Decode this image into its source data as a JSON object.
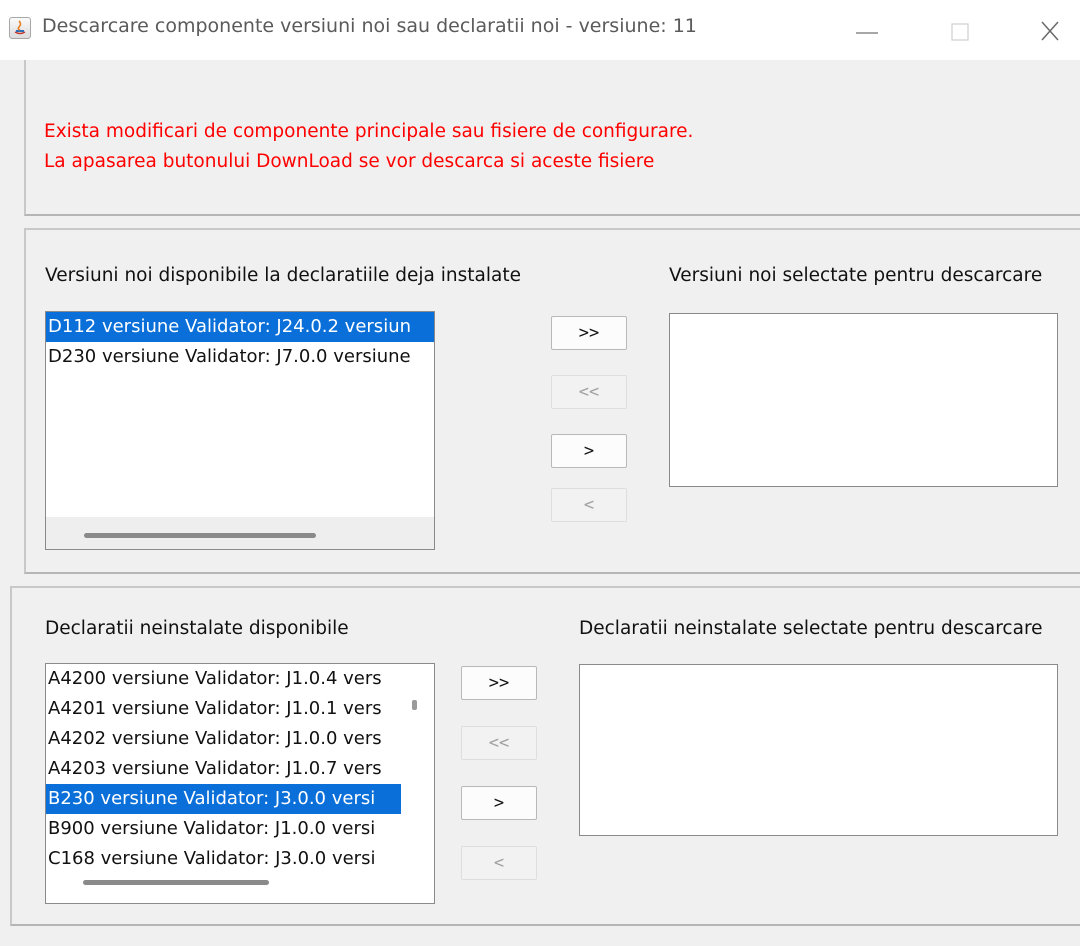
{
  "window": {
    "title": "Descarcare componente versiuni noi sau declaratii noi - versiune: 11",
    "app_icon": "java-icon",
    "controls": {
      "minimize": "—",
      "maximize": "☐",
      "close": "✕"
    }
  },
  "notice": {
    "line1": "Exista modificari de componente principale sau fisiere de configurare.",
    "line2": "La apasarea butonului DownLoad se vor descarca si aceste fisiere",
    "color": "#ff0000"
  },
  "updates": {
    "available_label": "Versiuni noi disponibile la declaratiile deja instalate",
    "selected_label": "Versiuni noi selectate pentru descarcare",
    "available_items": [
      "D112 versiune Validator: J24.0.2 versiun",
      "D230 versiune Validator: J7.0.0 versiune"
    ],
    "selected_index": 0,
    "selected_items": [],
    "buttons": {
      "add_all": ">>",
      "remove_all": "<<",
      "add": ">",
      "remove": "<"
    }
  },
  "new_declarations": {
    "available_label": "Declaratii neinstalate disponibile",
    "selected_label": "Declaratii neinstalate selectate pentru descarcare",
    "available_items": [
      "A4200 versiune Validator: J1.0.4 vers",
      "A4201 versiune Validator: J1.0.1 vers",
      "A4202 versiune Validator: J1.0.0 vers",
      "A4203 versiune Validator: J1.0.7 vers",
      "B230 versiune Validator: J3.0.0 versi",
      "B900 versiune Validator: J1.0.0 versi",
      "C168 versiune Validator: J3.0.0 versi"
    ],
    "selected_index": 4,
    "selected_items": [],
    "buttons": {
      "add_all": ">>",
      "remove_all": "<<",
      "add": ">",
      "remove": "<"
    }
  },
  "colors": {
    "selection": "#0a6fd8",
    "background": "#f0f0f0"
  }
}
